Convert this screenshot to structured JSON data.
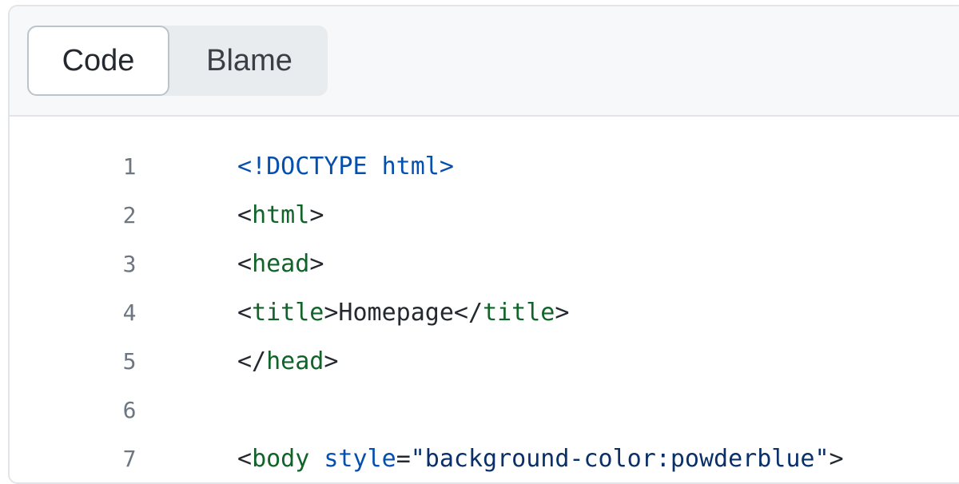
{
  "tabs": {
    "code_label": "Code",
    "blame_label": "Blame"
  },
  "lines": [
    {
      "number": "1",
      "parts": [
        {
          "text": "<!DOCTYPE html>",
          "type": "doctype"
        }
      ]
    },
    {
      "number": "2",
      "parts": [
        {
          "text": "<",
          "type": "plain"
        },
        {
          "text": "html",
          "type": "tag"
        },
        {
          "text": ">",
          "type": "plain"
        }
      ]
    },
    {
      "number": "3",
      "parts": [
        {
          "text": "<",
          "type": "plain"
        },
        {
          "text": "head",
          "type": "tag"
        },
        {
          "text": ">",
          "type": "plain"
        }
      ]
    },
    {
      "number": "4",
      "parts": [
        {
          "text": "<",
          "type": "plain"
        },
        {
          "text": "title",
          "type": "tag"
        },
        {
          "text": ">Homepage</",
          "type": "plain"
        },
        {
          "text": "title",
          "type": "tag"
        },
        {
          "text": ">",
          "type": "plain"
        }
      ]
    },
    {
      "number": "5",
      "parts": [
        {
          "text": "</",
          "type": "plain"
        },
        {
          "text": "head",
          "type": "tag"
        },
        {
          "text": ">",
          "type": "plain"
        }
      ]
    },
    {
      "number": "6",
      "parts": []
    },
    {
      "number": "7",
      "parts": [
        {
          "text": "<",
          "type": "plain"
        },
        {
          "text": "body",
          "type": "tag"
        },
        {
          "text": " ",
          "type": "plain"
        },
        {
          "text": "style",
          "type": "attr"
        },
        {
          "text": "=",
          "type": "plain"
        },
        {
          "text": "\"background-color:powderblue\"",
          "type": "str"
        },
        {
          "text": ">",
          "type": "plain"
        }
      ]
    }
  ],
  "colors": {
    "doctype": "#0550ae",
    "tag": "#116329",
    "attr": "#0550ae",
    "string": "#0a3069",
    "line_number": "#6e7781"
  }
}
